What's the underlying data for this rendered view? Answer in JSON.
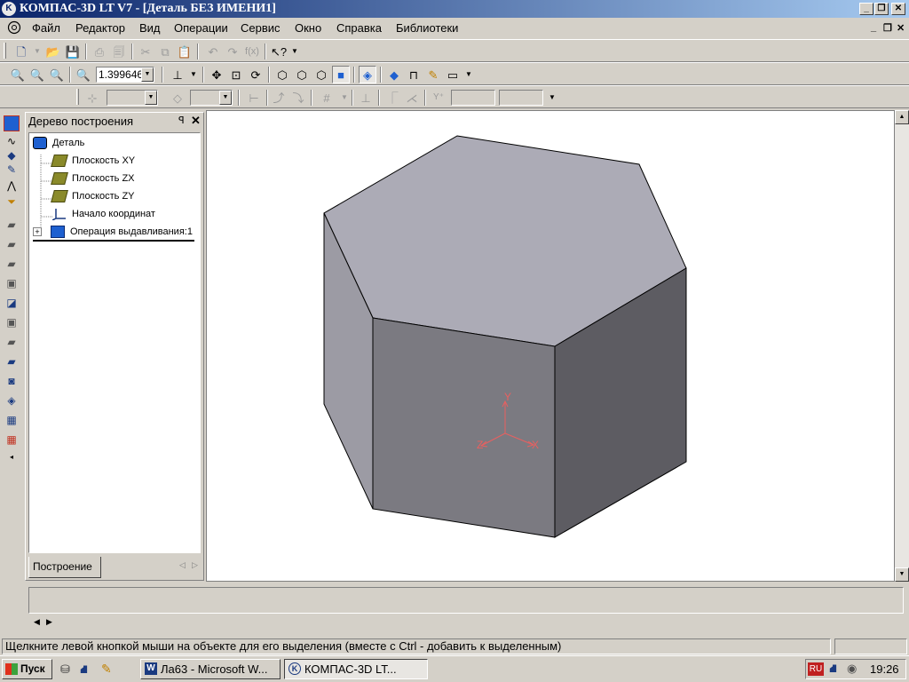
{
  "titlebar": {
    "title": "КОМПАС-3D LT V7 - [Деталь БЕЗ ИМЕНИ1]",
    "min": "_",
    "restore": "❐",
    "close": "✕"
  },
  "menu": {
    "items": [
      "Файл",
      "Редактор",
      "Вид",
      "Операции",
      "Сервис",
      "Окно",
      "Справка",
      "Библиотеки"
    ],
    "doc_min": "_",
    "doc_restore": "❐",
    "doc_close": "✕"
  },
  "toolbar_view": {
    "zoom_value": "1.399646"
  },
  "tree_panel": {
    "title": "Дерево построения",
    "pin": "ꟼ",
    "close": "✕",
    "root": "Деталь",
    "items": [
      "Плоскость XY",
      "Плоскость ZX",
      "Плоскость ZY",
      "Начало координат",
      "Операция выдавливания:1"
    ],
    "expand": "+",
    "tab": "Построение"
  },
  "axes": {
    "x": "X",
    "y": "Y",
    "z": "Z"
  },
  "statusbar": {
    "text": "Щелкните левой кнопкой мыши на объекте для его выделения (вместе с Ctrl - добавить к выделенным)"
  },
  "taskbar": {
    "start": "Пуск",
    "tasks": [
      "Ла63 - Microsoft W...",
      "КОМПАС-3D LT..."
    ],
    "lang": "RU",
    "clock": "19:26"
  },
  "colors": {
    "titlebar_start": "#0a246a",
    "titlebar_end": "#a6caf0",
    "face_top": "#acabb6",
    "face_front": "#7b7a81",
    "face_right": "#5d5c62",
    "face_left": "#9c9ba4",
    "axis": "#e86060"
  }
}
